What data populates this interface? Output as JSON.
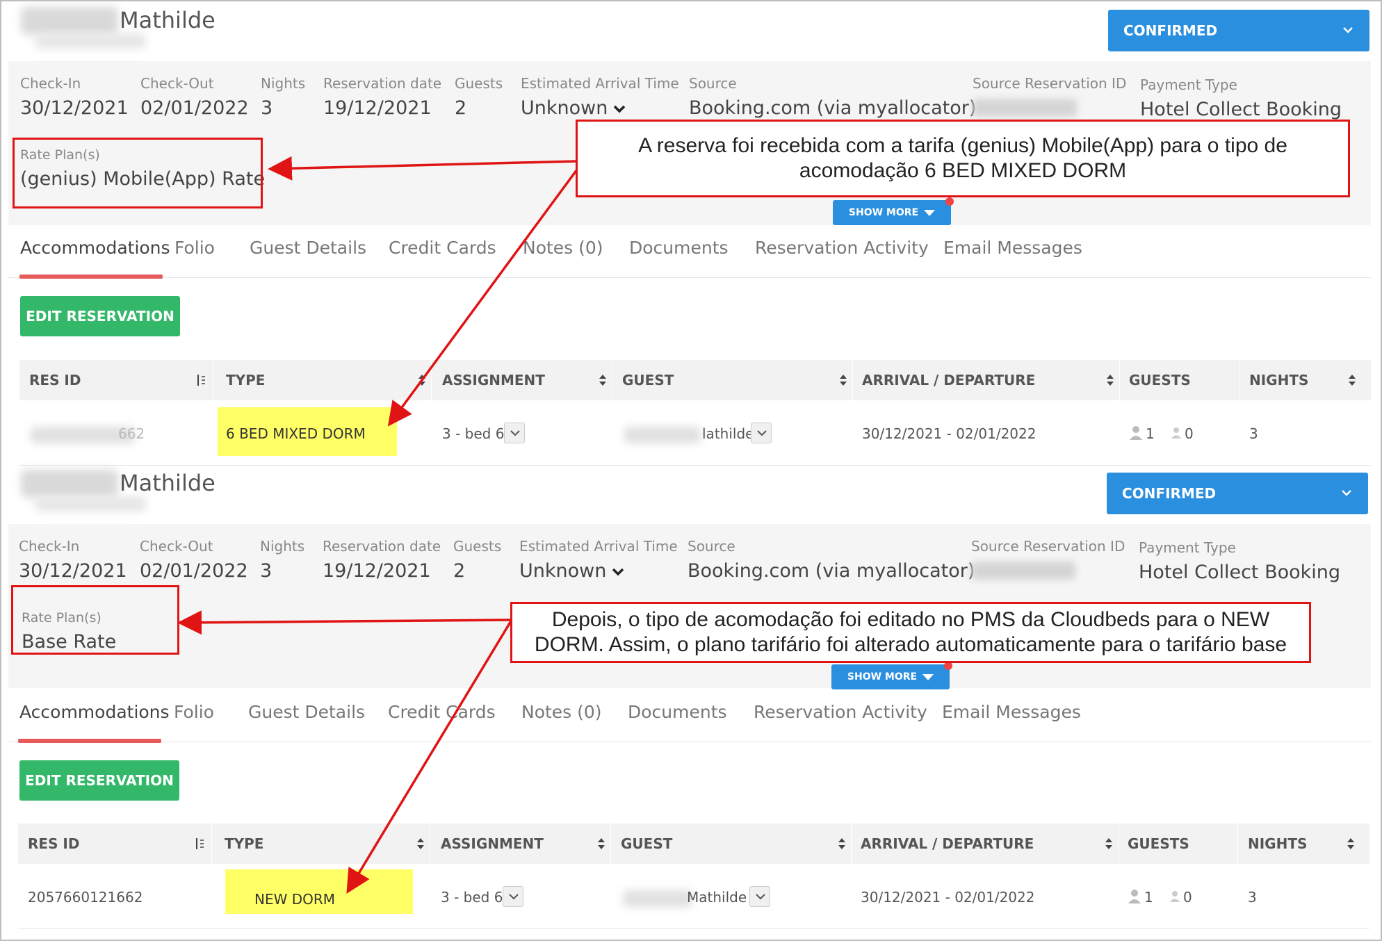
{
  "panels": [
    {
      "guest_name": "Mathilde",
      "status": "CONFIRMED",
      "fields": {
        "checkin_label": "Check-In",
        "checkin_value": "30/12/2021",
        "checkout_label": "Check-Out",
        "checkout_value": "02/01/2022",
        "nights_label": "Nights",
        "nights_value": "3",
        "resdate_label": "Reservation date",
        "resdate_value": "19/12/2021",
        "guests_label": "Guests",
        "guests_value": "2",
        "eta_label": "Estimated Arrival Time",
        "eta_value": "Unknown",
        "source_label": "Source",
        "source_value": "Booking.com (via myallocator)",
        "srcid_label": "Source Reservation ID",
        "payment_label": "Payment Type",
        "payment_value": "Hotel Collect Booking"
      },
      "rate_label": "Rate Plan(s)",
      "rate_value": "(genius) Mobile(App) Rate",
      "show_more": "SHOW MORE",
      "tabs": [
        "Accommodations",
        "Folio",
        "Guest Details",
        "Credit Cards",
        "Notes (0)",
        "Documents",
        "Reservation Activity",
        "Email Messages"
      ],
      "edit_button": "EDIT RESERVATION",
      "columns": [
        "RES ID",
        "TYPE",
        "ASSIGNMENT",
        "GUEST",
        "ARRIVAL / DEPARTURE",
        "GUESTS",
        "NIGHTS"
      ],
      "row": {
        "res_id": "",
        "res_id_tail": "662",
        "type": "6 BED MIXED DORM",
        "assignment": "3 - bed 6",
        "guest": "lathilde",
        "dates": "30/12/2021 - 02/01/2022",
        "adults": "1",
        "children": "0",
        "nights": "3"
      },
      "callout": "A reserva foi recebida com a tarifa (genius) Mobile(App) para o tipo de acomodação 6 BED MIXED DORM"
    },
    {
      "guest_name": "Mathilde",
      "status": "CONFIRMED",
      "fields": {
        "checkin_label": "Check-In",
        "checkin_value": "30/12/2021",
        "checkout_label": "Check-Out",
        "checkout_value": "02/01/2022",
        "nights_label": "Nights",
        "nights_value": "3",
        "resdate_label": "Reservation date",
        "resdate_value": "19/12/2021",
        "guests_label": "Guests",
        "guests_value": "2",
        "eta_label": "Estimated Arrival Time",
        "eta_value": "Unknown",
        "source_label": "Source",
        "source_value": "Booking.com (via myallocator)",
        "srcid_label": "Source Reservation ID",
        "payment_label": "Payment Type",
        "payment_value": "Hotel Collect Booking"
      },
      "rate_label": "Rate Plan(s)",
      "rate_value": "Base Rate",
      "show_more": "SHOW MORE",
      "tabs": [
        "Accommodations",
        "Folio",
        "Guest Details",
        "Credit Cards",
        "Notes (0)",
        "Documents",
        "Reservation Activity",
        "Email Messages"
      ],
      "edit_button": "EDIT RESERVATION",
      "columns": [
        "RES ID",
        "TYPE",
        "ASSIGNMENT",
        "GUEST",
        "ARRIVAL / DEPARTURE",
        "GUESTS",
        "NIGHTS"
      ],
      "row": {
        "res_id": "2057660121662",
        "res_id_tail": "",
        "type": "NEW DORM",
        "assignment": "3 - bed 6",
        "guest": "Mathilde",
        "dates": "30/12/2021 - 02/01/2022",
        "adults": "1",
        "children": "0",
        "nights": "3"
      },
      "callout": "Depois, o tipo de acomodação foi editado no PMS da Cloudbeds para o NEW DORM. Assim, o plano tarifário foi alterado automaticamente para o tarifário base"
    }
  ],
  "colors": {
    "status_blue": "#2b8fe0",
    "edit_green": "#33b86a",
    "annotation_red": "#e01414",
    "highlight_yellow": "#ffff66",
    "tab_underline": "#e85a5a"
  }
}
